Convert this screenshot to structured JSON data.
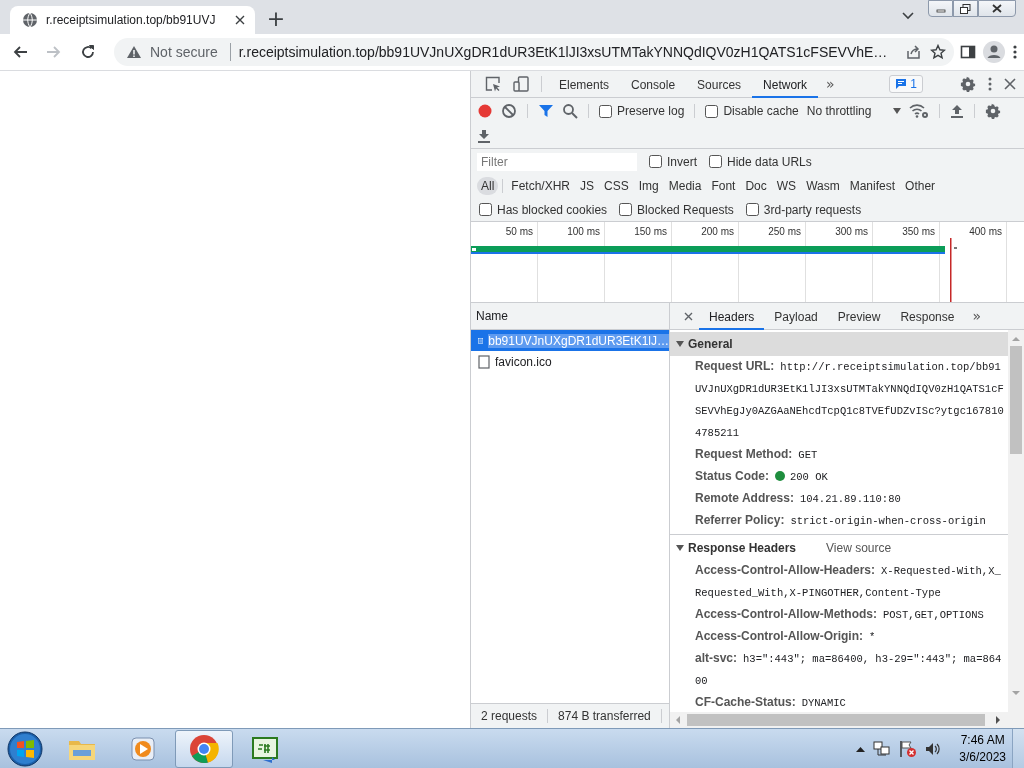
{
  "browser_tab": {
    "title": "r.receiptsimulation.top/bb91UVJ"
  },
  "new_tab_button": "+",
  "nav_buttons": [
    {
      "kind": "back",
      "disabled": false
    },
    {
      "kind": "forward",
      "disabled": true
    },
    {
      "kind": "reload",
      "disabled": false
    }
  ],
  "address_bar": {
    "security_label": "Not secure",
    "url": "r.receiptsimulation.top/bb91UVJnUXgDR1dUR3EtK1lJI3xsUTMTakYNNQdIQV0zH1QATS1cFSEVVhE…"
  },
  "devtools": {
    "tabs": [
      {
        "label": "Elements",
        "selected": false
      },
      {
        "label": "Console",
        "selected": false
      },
      {
        "label": "Sources",
        "selected": false
      },
      {
        "label": "Network",
        "selected": true
      }
    ],
    "more_tabs": "»",
    "issues_badge": "1",
    "toolbar": {
      "recording": true,
      "preserve_log": {
        "label": "Preserve log",
        "checked": false
      },
      "disable_cache": {
        "label": "Disable cache",
        "checked": false
      },
      "throttling": "No throttling"
    },
    "filter": {
      "placeholder": "Filter",
      "options": [
        {
          "label": "Invert",
          "checked": false
        },
        {
          "label": "Hide data URLs",
          "checked": false
        }
      ]
    },
    "resource_types": [
      {
        "label": "All",
        "selected": true
      },
      {
        "label": "Fetch/XHR",
        "selected": false
      },
      {
        "label": "JS",
        "selected": false
      },
      {
        "label": "CSS",
        "selected": false
      },
      {
        "label": "Img",
        "selected": false
      },
      {
        "label": "Media",
        "selected": false
      },
      {
        "label": "Font",
        "selected": false
      },
      {
        "label": "Doc",
        "selected": false
      },
      {
        "label": "WS",
        "selected": false
      },
      {
        "label": "Wasm",
        "selected": false
      },
      {
        "label": "Manifest",
        "selected": false
      },
      {
        "label": "Other",
        "selected": false
      }
    ],
    "more_filters": [
      {
        "label": "Has blocked cookies",
        "checked": false
      },
      {
        "label": "Blocked Requests",
        "checked": false
      },
      {
        "label": "3rd-party requests",
        "checked": false
      }
    ],
    "timeline": {
      "ticks": [
        "50 ms",
        "100 ms",
        "150 ms",
        "200 ms",
        "250 ms",
        "300 ms",
        "350 ms",
        "400 ms"
      ]
    },
    "requests": {
      "column": "Name",
      "rows": [
        {
          "name": "bb91UVJnUXgDR1dUR3EtK1lJ…",
          "kind": "document",
          "selected": true
        },
        {
          "name": "favicon.ico",
          "kind": "other",
          "selected": false
        }
      ],
      "status": [
        "2 requests",
        "874 B transferred"
      ]
    },
    "details": {
      "tabs": [
        {
          "label": "Headers",
          "selected": true
        },
        {
          "label": "Payload",
          "selected": false
        },
        {
          "label": "Preview",
          "selected": false
        },
        {
          "label": "Response",
          "selected": false
        }
      ],
      "more_tabs": "»",
      "sections": [
        {
          "title": "General",
          "expanded": true,
          "rows": [
            {
              "name": "Request URL:",
              "value": "http://r.receiptsimulation.top/bb91UVJnUXgDR1dUR3EtK1lJI3xsUTMTakYNNQdIQV0zH1QATS1cFSEVVhEgJy0AZGAaNEhcdTcpQ1c8TVEfUDZvISc?ytgc1678104785211"
            },
            {
              "name": "Request Method:",
              "value": "GET"
            },
            {
              "name": "Status Code:",
              "value": "200 OK",
              "kind": "status"
            },
            {
              "name": "Remote Address:",
              "value": "104.21.89.110:80"
            },
            {
              "name": "Referrer Policy:",
              "value": "strict-origin-when-cross-origin"
            }
          ]
        },
        {
          "title": "Response Headers",
          "expanded": true,
          "link": "View source",
          "rows": [
            {
              "name": "Access-Control-Allow-Headers:",
              "value": "X-Requested-With,X_Requested_With,X-PINGOTHER,Content-Type"
            },
            {
              "name": "Access-Control-Allow-Methods:",
              "value": "POST,GET,OPTIONS"
            },
            {
              "name": "Access-Control-Allow-Origin:",
              "value": "*"
            },
            {
              "name": "alt-svc:",
              "value": "h3=\":443\"; ma=86400, h3-29=\":443\"; ma=86400"
            },
            {
              "name": "CF-Cache-Status:",
              "value": "DYNAMIC"
            }
          ]
        }
      ]
    }
  },
  "taskbar": {
    "apps": [
      {
        "kind": "explorer",
        "selected": false
      },
      {
        "kind": "media",
        "selected": false
      },
      {
        "kind": "chrome",
        "selected": true
      },
      {
        "kind": "csharp",
        "selected": false
      }
    ],
    "time": "7:46 AM",
    "date": "3/6/2023"
  }
}
